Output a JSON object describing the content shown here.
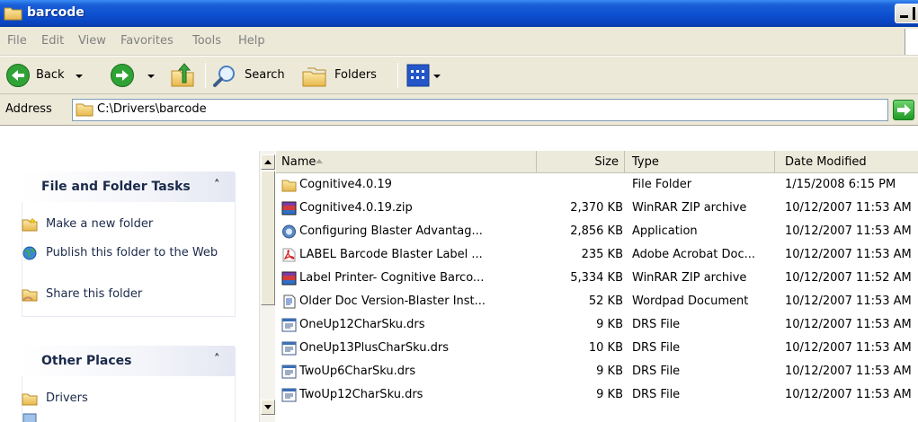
{
  "window": {
    "title": "barcode"
  },
  "menu": [
    "File",
    "Edit",
    "View",
    "Favorites",
    "Tools",
    "Help"
  ],
  "toolbar": {
    "back": "Back",
    "search": "Search",
    "folders": "Folders"
  },
  "address": {
    "label": "Address",
    "value": "C:\\Drivers\\barcode"
  },
  "tasks": {
    "title": "File and Folder Tasks",
    "items": [
      {
        "label": "Make a new folder",
        "icon": "new-folder-icon"
      },
      {
        "label": "Publish this folder to the Web",
        "icon": "publish-web-icon"
      },
      {
        "label": "Share this folder",
        "icon": "share-folder-icon"
      }
    ]
  },
  "other_places": {
    "title": "Other Places",
    "items": [
      {
        "label": "Drivers",
        "icon": "folder-icon"
      }
    ]
  },
  "columns": {
    "name": "Name",
    "size": "Size",
    "type": "Type",
    "date": "Date Modified"
  },
  "files": [
    {
      "name": "Cognitive4.0.19",
      "size": "",
      "type": "File Folder",
      "date": "1/15/2008 6:15 PM",
      "icon": "folder"
    },
    {
      "name": "Cognitive4.0.19.zip",
      "size": "2,370 KB",
      "type": "WinRAR ZIP archive",
      "date": "10/12/2007 11:53 AM",
      "icon": "winrar"
    },
    {
      "name": "Configuring Blaster Advantag...",
      "size": "2,856 KB",
      "type": "Application",
      "date": "10/12/2007 11:53 AM",
      "icon": "app"
    },
    {
      "name": "LABEL Barcode Blaster Label ...",
      "size": "235 KB",
      "type": "Adobe Acrobat Doc...",
      "date": "10/12/2007 11:53 AM",
      "icon": "pdf"
    },
    {
      "name": "Label Printer- Cognitive Barco...",
      "size": "5,334 KB",
      "type": "WinRAR ZIP archive",
      "date": "10/12/2007 11:52 AM",
      "icon": "winrar"
    },
    {
      "name": "Older Doc Version-Blaster Inst...",
      "size": "52 KB",
      "type": "Wordpad Document",
      "date": "10/12/2007 11:53 AM",
      "icon": "wordpad"
    },
    {
      "name": "OneUp12CharSku.drs",
      "size": "9 KB",
      "type": "DRS File",
      "date": "10/12/2007 11:53 AM",
      "icon": "drs"
    },
    {
      "name": "OneUp13PlusCharSku.drs",
      "size": "10 KB",
      "type": "DRS File",
      "date": "10/12/2007 11:53 AM",
      "icon": "drs"
    },
    {
      "name": "TwoUp6CharSku.drs",
      "size": "9 KB",
      "type": "DRS File",
      "date": "10/12/2007 11:53 AM",
      "icon": "drs"
    },
    {
      "name": "TwoUp12CharSku.drs",
      "size": "9 KB",
      "type": "DRS File",
      "date": "10/12/2007 11:53 AM",
      "icon": "drs"
    }
  ]
}
